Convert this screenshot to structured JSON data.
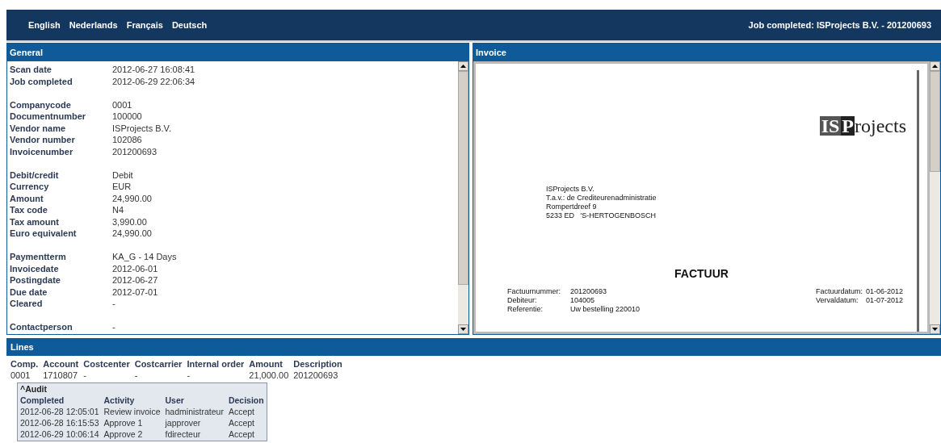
{
  "languages": [
    "English",
    "Nederlands",
    "Français",
    "Deutsch"
  ],
  "header_title": "Job completed: ISProjects B.V. - 201200693",
  "general": {
    "title": "General",
    "groups": [
      [
        {
          "label": "Scan date",
          "value": "2012-06-27 16:08:41"
        },
        {
          "label": "Job completed",
          "value": "2012-06-29 22:06:34"
        }
      ],
      [
        {
          "label": "Companycode",
          "value": "0001"
        },
        {
          "label": "Documentnumber",
          "value": "100000"
        },
        {
          "label": "Vendor name",
          "value": "ISProjects B.V."
        },
        {
          "label": "Vendor number",
          "value": "102086"
        },
        {
          "label": "Invoicenumber",
          "value": "201200693"
        }
      ],
      [
        {
          "label": "Debit/credit",
          "value": "Debit"
        },
        {
          "label": "Currency",
          "value": "EUR"
        },
        {
          "label": "Amount",
          "value": "24,990.00"
        },
        {
          "label": "Tax code",
          "value": "N4"
        },
        {
          "label": "Tax amount",
          "value": "3,990.00"
        },
        {
          "label": "Euro equivalent",
          "value": "24,990.00"
        }
      ],
      [
        {
          "label": "Paymentterm",
          "value": "KA_G - 14 Days"
        },
        {
          "label": "Invoicedate",
          "value": "2012-06-01"
        },
        {
          "label": "Postingdate",
          "value": "2012-06-27"
        },
        {
          "label": "Due date",
          "value": "2012-07-01"
        },
        {
          "label": "Cleared",
          "value": "-"
        }
      ],
      [
        {
          "label": "Contactperson",
          "value": "-"
        }
      ]
    ]
  },
  "invoice": {
    "title": "Invoice",
    "logo": {
      "boxed": "IS",
      "dark": "P",
      "rest": "rojects"
    },
    "address": [
      "ISProjects B.V.",
      "T.a.v.: de Crediteurenadministratie",
      "Rompertdreef 9",
      "5233 ED   'S-HERTOGENBOSCH"
    ],
    "heading": "FACTUUR",
    "left_fields": [
      {
        "label": "Factuurnummer:",
        "value": "201200693"
      },
      {
        "label": "Debiteur:",
        "value": "104005"
      },
      {
        "label": "Referentie:",
        "value": "Uw bestelling 220010"
      }
    ],
    "right_fields": [
      {
        "label": "Factuurdatum:",
        "value": "01-06-2012"
      },
      {
        "label": "Vervaldatum:",
        "value": "01-07-2012"
      }
    ]
  },
  "lines": {
    "title": "Lines",
    "columns": [
      "Comp.",
      "Account",
      "Costcenter",
      "Costcarrier",
      "Internal order",
      "Amount",
      "Description"
    ],
    "rows": [
      [
        "0001",
        "1710807",
        "-",
        "-",
        "-",
        "21,000.00",
        "201200693"
      ]
    ]
  },
  "audit": {
    "toggle": "^Audit",
    "columns": [
      "Completed",
      "Activity",
      "User",
      "Decision"
    ],
    "rows": [
      [
        "2012-06-28 12:05:01",
        "Review invoice",
        "hadministrateur",
        "Accept"
      ],
      [
        "2012-06-28 16:15:53",
        "Approve 1",
        "japprover",
        "Accept"
      ],
      [
        "2012-06-29 10:06:14",
        "Approve 2",
        "fdirecteur",
        "Accept"
      ]
    ]
  }
}
